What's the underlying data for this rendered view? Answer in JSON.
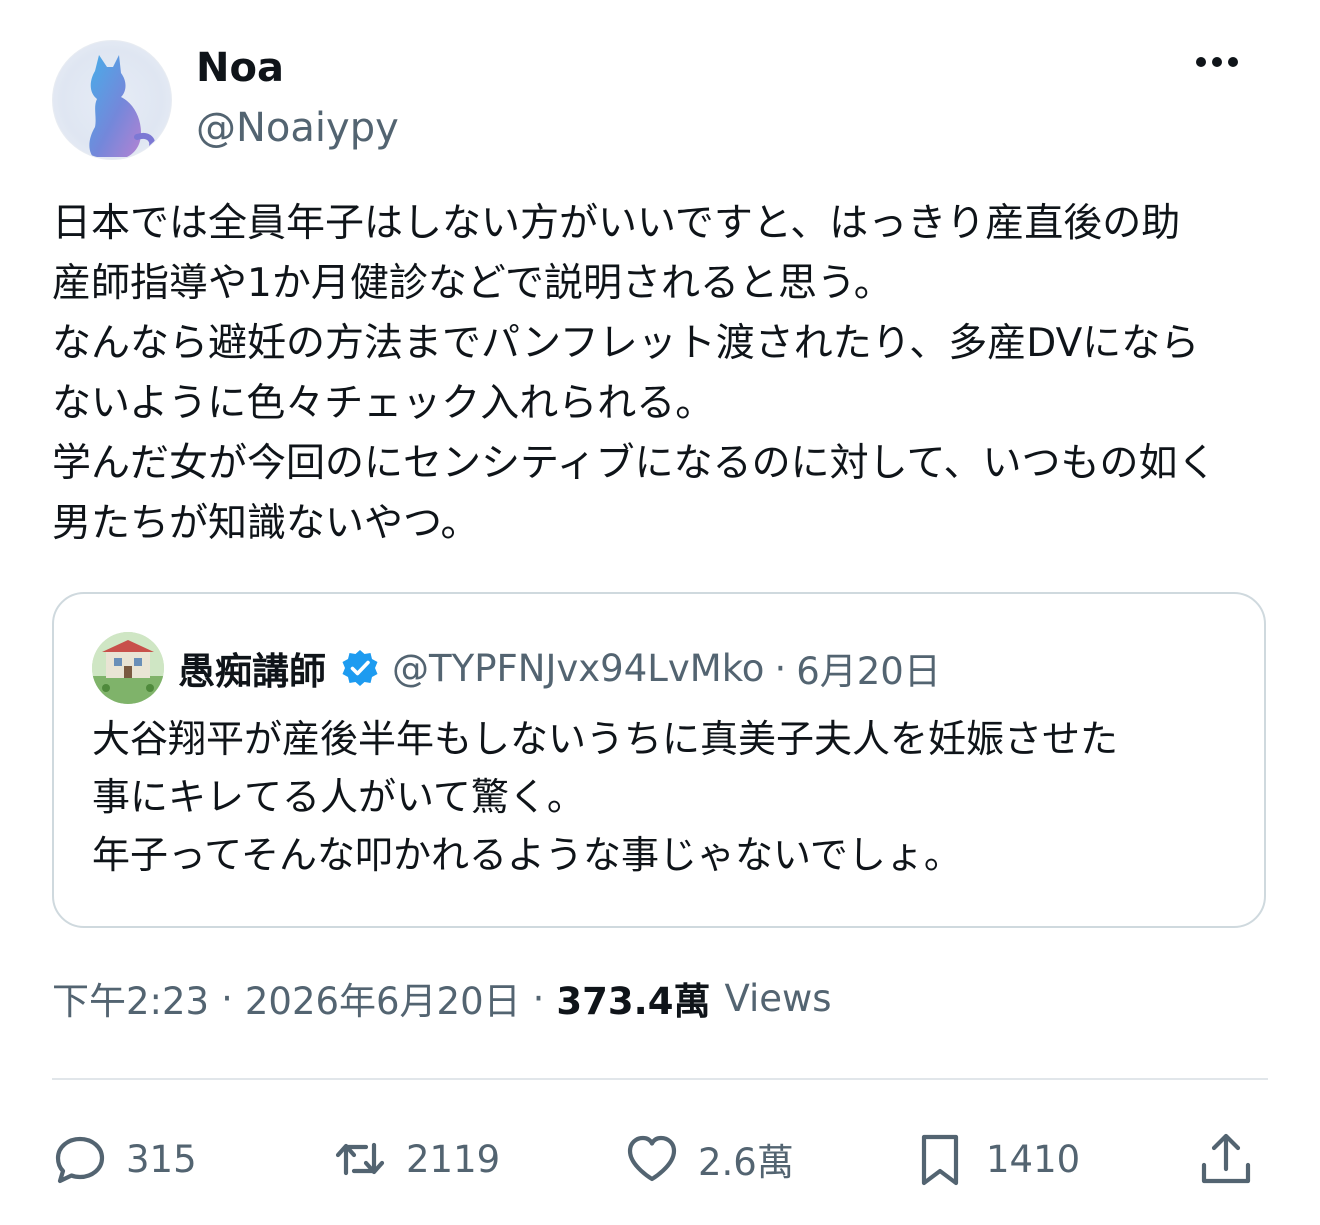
{
  "author": {
    "name": "Noa",
    "handle": "@Noaiypy"
  },
  "tweet": {
    "text": "日本では全員年子はしない方がいいですと、はっきり産直後の助\n産師指導や1か月健診などで説明されると思う。\nなんなら避妊の方法までパンフレット渡されたり、多産DVになら\nないように色々チェック入れられる。\n学んだ女が今回のにセンシティブになるのに対して、いつもの如く\n男たちが知識ないやつ。"
  },
  "quoted": {
    "name": "愚痴講師",
    "handle": "@TYPFNJvx94LvMko",
    "separator": "·",
    "date": "6月20日",
    "text": "大谷翔平が産後半年もしないうちに真美子夫人を妊娠させた\n事にキレてる人がいて驚く。\n年子ってそんな叩かれるような事じゃないでしょ。"
  },
  "meta": {
    "time": "下午2:23",
    "separator": "·",
    "date": "2026年6月20日",
    "views_count": "373.4萬",
    "views_label": "Views"
  },
  "actions": {
    "replies": "315",
    "reposts": "2119",
    "likes": "2.6萬",
    "bookmarks": "1410"
  },
  "colors": {
    "text": "#0f1419",
    "secondary": "#536471",
    "border": "#cfd9de",
    "verified": "#1d9bf0"
  },
  "icons": [
    "more-icon",
    "verified-badge-icon",
    "reply-icon",
    "repost-icon",
    "like-icon",
    "bookmark-icon",
    "share-icon"
  ]
}
